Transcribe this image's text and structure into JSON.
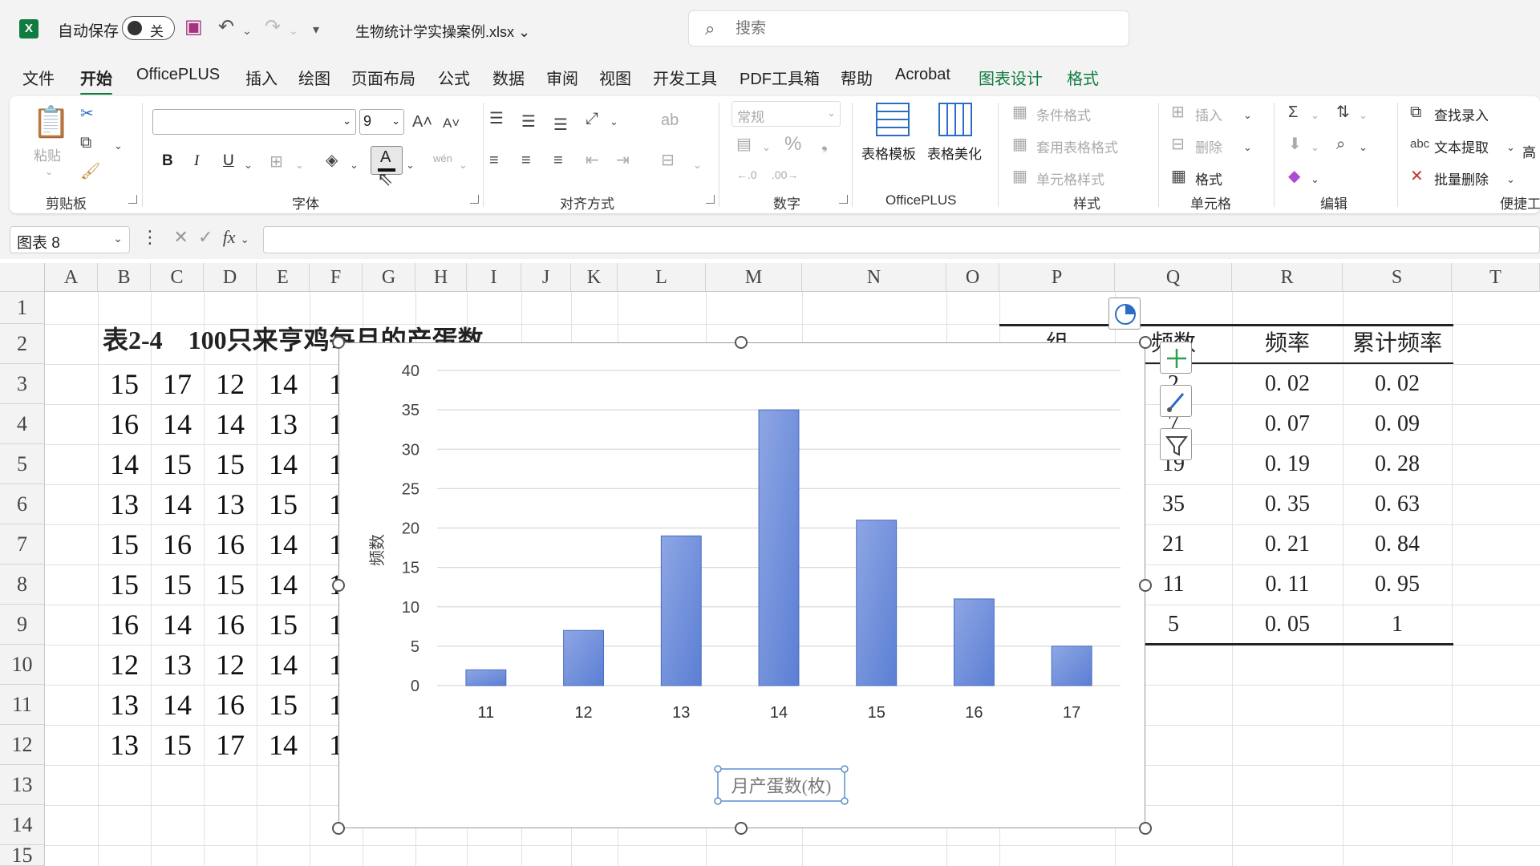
{
  "titlebar": {
    "app_icon": "X",
    "autosave_label": "自动保存",
    "autosave_state": "关",
    "filename": "生物统计学实操案例.xlsx",
    "search_placeholder": "搜索",
    "icons": [
      "excel-icon",
      "save-icon",
      "undo-icon",
      "redo-icon",
      "customize-icon",
      "search-icon"
    ]
  },
  "tabs": [
    {
      "label": "文件"
    },
    {
      "label": "开始"
    },
    {
      "label": "OfficePLUS"
    },
    {
      "label": "插入"
    },
    {
      "label": "绘图"
    },
    {
      "label": "页面布局"
    },
    {
      "label": "公式"
    },
    {
      "label": "数据"
    },
    {
      "label": "审阅"
    },
    {
      "label": "视图"
    },
    {
      "label": "开发工具"
    },
    {
      "label": "PDF工具箱"
    },
    {
      "label": "帮助"
    },
    {
      "label": "Acrobat"
    },
    {
      "label": "图表设计"
    },
    {
      "label": "格式"
    }
  ],
  "active_tab": "开始",
  "ribbon": {
    "clipboard": {
      "label": "剪贴板",
      "paste": "粘贴"
    },
    "font": {
      "label": "字体",
      "font_name": "",
      "font_size": "9",
      "bold": "B",
      "italic": "I",
      "underline": "U",
      "font_color": "A"
    },
    "alignment": {
      "label": "对齐方式"
    },
    "number": {
      "label": "数字",
      "format": "常规",
      "percent": "%"
    },
    "officeplus": {
      "label": "OfficePLUS",
      "template": "表格模板",
      "beautify": "表格美化"
    },
    "styles": {
      "label": "样式",
      "conditional": "条件格式",
      "table_format": "套用表格格式",
      "cell_styles": "单元格样式"
    },
    "cells": {
      "label": "单元格",
      "insert": "插入",
      "delete": "删除",
      "format": "格式"
    },
    "editing": {
      "label": "编辑"
    },
    "tools": {
      "label": "便捷工",
      "find_entry": "查找录入",
      "text_extract": "文本提取",
      "batch_delete": "批量删除",
      "more": "高"
    }
  },
  "formula_bar": {
    "name_box": "图表 8",
    "fx": "fx",
    "formula": ""
  },
  "grid": {
    "columns": [
      "A",
      "B",
      "C",
      "D",
      "E",
      "F",
      "G",
      "H",
      "I",
      "J",
      "K",
      "L",
      "M",
      "N",
      "O",
      "P",
      "Q",
      "R",
      "S",
      "T"
    ],
    "rows": [
      "1",
      "2",
      "3",
      "4",
      "5",
      "6",
      "7",
      "8",
      "9",
      "10",
      "11",
      "12",
      "13",
      "14",
      "15"
    ],
    "table_title": "表2-4　100只来亨鸡每月的产蛋数",
    "data_rows": [
      [
        "15",
        "17",
        "12",
        "14",
        "1"
      ],
      [
        "16",
        "14",
        "14",
        "13",
        "1"
      ],
      [
        "14",
        "15",
        "15",
        "14",
        "1"
      ],
      [
        "13",
        "14",
        "13",
        "15",
        "1"
      ],
      [
        "15",
        "16",
        "16",
        "14",
        "1"
      ],
      [
        "15",
        "15",
        "15",
        "14",
        "1"
      ],
      [
        "16",
        "14",
        "16",
        "15",
        "1"
      ],
      [
        "12",
        "13",
        "12",
        "14",
        "1"
      ],
      [
        "13",
        "14",
        "16",
        "15",
        "1"
      ],
      [
        "13",
        "15",
        "17",
        "14",
        "1"
      ]
    ],
    "right_table": {
      "headers": [
        "组",
        "频数",
        "频率",
        "累计频率"
      ],
      "rows": [
        [
          "2",
          "0. 02",
          "0. 02"
        ],
        [
          "7",
          "0. 07",
          "0. 09"
        ],
        [
          "19",
          "0. 19",
          "0. 28"
        ],
        [
          "35",
          "0. 35",
          "0. 63"
        ],
        [
          "21",
          "0. 21",
          "0. 84"
        ],
        [
          "11",
          "0. 11",
          "0. 95"
        ],
        [
          "5",
          "0. 05",
          "1"
        ]
      ]
    }
  },
  "chart_data": {
    "type": "bar",
    "categories": [
      "11",
      "12",
      "13",
      "14",
      "15",
      "16",
      "17"
    ],
    "values": [
      2,
      7,
      19,
      35,
      21,
      11,
      5
    ],
    "title": "",
    "xlabel": "月产蛋数(枚)",
    "ylabel": "频数",
    "ylim": [
      0,
      40
    ],
    "yticks": [
      0,
      5,
      10,
      15,
      20,
      25,
      30,
      35,
      40
    ],
    "grid": true,
    "bar_color": "#5b7fd4",
    "legend": "none"
  },
  "chart_tools": [
    "chart-layout-icon",
    "chart-elements-icon",
    "chart-styles-icon",
    "chart-filters-icon"
  ]
}
